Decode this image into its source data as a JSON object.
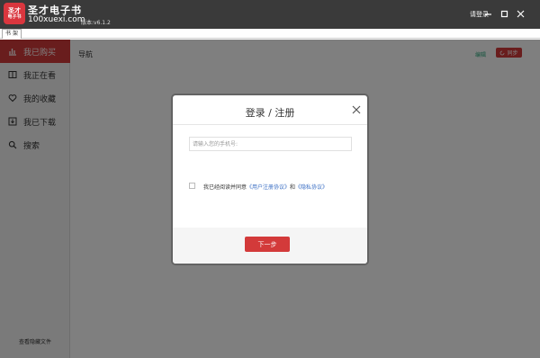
{
  "app": {
    "logo_top": "圣才",
    "logo_bottom": "电子书",
    "name": "圣才电子书",
    "domain": "100xuexi.com",
    "version": "版本:v6.1.2",
    "login_link": "请登录"
  },
  "tabs": [
    {
      "label": "书 架"
    }
  ],
  "sidebar": {
    "items": [
      {
        "label": "我已购买",
        "icon": "bar-chart-icon",
        "active": true
      },
      {
        "label": "我正在看",
        "icon": "book-icon",
        "active": false
      },
      {
        "label": "我的收藏",
        "icon": "heart-icon",
        "active": false
      },
      {
        "label": "我已下载",
        "icon": "download-icon",
        "active": false
      },
      {
        "label": "搜索",
        "icon": "search-icon",
        "active": false
      }
    ],
    "footer": "查看隐藏文件"
  },
  "main": {
    "title": "导航",
    "edit": "编辑",
    "sync": "同步"
  },
  "dialog": {
    "title": "登录 / 注册",
    "phone_placeholder": "请输入您的手机号:",
    "agree_prefix": "我已经阅读并同意",
    "user_agreement": "《用户注册协议》",
    "and": "和",
    "privacy": "《隐私协议》",
    "next": "下一步"
  },
  "colors": {
    "accent": "#d33a3a",
    "titlebar": "#3a3a3a",
    "link": "#3b6fc4",
    "edit": "#2aa77c"
  }
}
